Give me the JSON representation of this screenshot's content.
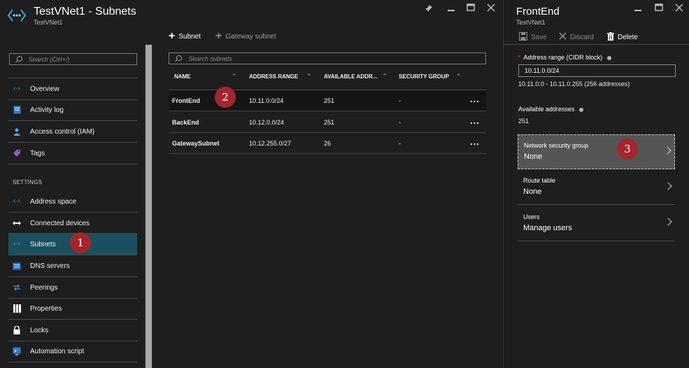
{
  "left_blade": {
    "title": "TestVNet1 - Subnets",
    "subtitle": "TestVNet1",
    "toolbar": {
      "subnet_label": "Subnet",
      "gateway_subnet_label": "Gateway subnet"
    }
  },
  "sidebar": {
    "search_placeholder": "Search (Ctrl+/)",
    "items": [
      {
        "label": "Overview",
        "icon": "vnet-icon"
      },
      {
        "label": "Activity log",
        "icon": "activity-log-icon"
      },
      {
        "label": "Access control (IAM)",
        "icon": "iam-icon"
      },
      {
        "label": "Tags",
        "icon": "tag-icon"
      }
    ],
    "settings_header": "SETTINGS",
    "settings_items": [
      {
        "label": "Address space",
        "icon": "address-space-icon"
      },
      {
        "label": "Connected devices",
        "icon": "connected-devices-icon"
      },
      {
        "label": "Subnets",
        "icon": "subnets-icon",
        "selected": true
      },
      {
        "label": "DNS servers",
        "icon": "dns-icon"
      },
      {
        "label": "Peerings",
        "icon": "peerings-icon"
      },
      {
        "label": "Properties",
        "icon": "properties-icon"
      },
      {
        "label": "Locks",
        "icon": "lock-icon"
      },
      {
        "label": "Automation script",
        "icon": "automation-icon"
      }
    ]
  },
  "subnets": {
    "search_placeholder": "Search subnets",
    "columns": [
      "NAME",
      "ADDRESS RANGE",
      "AVAILABLE ADDR...",
      "SECURITY GROUP"
    ],
    "rows": [
      {
        "name": "FrontEnd",
        "range": "10.11.0.0/24",
        "available": "251",
        "security": "-"
      },
      {
        "name": "BackEnd",
        "range": "10.12.0.0/24",
        "available": "251",
        "security": "-"
      },
      {
        "name": "GatewaySubnet",
        "range": "10.12.255.0/27",
        "available": "26",
        "security": "-"
      }
    ],
    "more_label": "..."
  },
  "right_blade": {
    "title": "FrontEnd",
    "subtitle": "TestVNet1",
    "toolbar": {
      "save_label": "Save",
      "discard_label": "Discard",
      "delete_label": "Delete"
    },
    "address_range_required": "*",
    "address_range_label": "Address range (CIDR block)",
    "address_range_value": "10.11.0.0/24",
    "address_range_span": "10.11.0.0 - 10.11.0.255 (256 addresses)",
    "available_label": "Available addresses",
    "available_value": "251",
    "links": [
      {
        "label": "Network security group",
        "value": "None"
      },
      {
        "label": "Route table",
        "value": "None"
      },
      {
        "label": "Users",
        "value": "Manage users"
      }
    ]
  },
  "badges": [
    "1",
    "2",
    "3"
  ],
  "colors": {
    "selected_nav": "#1b4f5f",
    "badge": "#a4262c",
    "vnet_icon": "#3aa0e0"
  }
}
